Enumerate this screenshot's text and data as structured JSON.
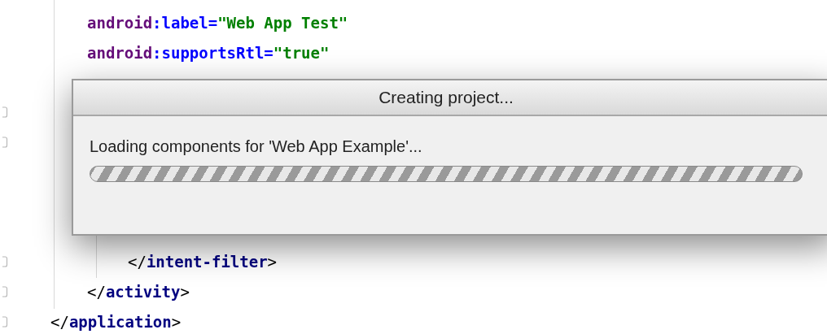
{
  "editor": {
    "lines": [
      {
        "tokens": [
          {
            "kind": "namespace",
            "text": "android"
          },
          {
            "kind": "attribute",
            "text": ":label="
          },
          {
            "kind": "value",
            "text": "\"Web App Test\""
          }
        ]
      },
      {
        "tokens": [
          {
            "kind": "namespace",
            "text": "android"
          },
          {
            "kind": "attribute",
            "text": ":supportsRtl="
          },
          {
            "kind": "value",
            "text": "\"true\""
          }
        ]
      },
      {
        "tokens": [
          {
            "kind": "punct",
            "text": "</"
          },
          {
            "kind": "tag",
            "text": "intent-filter"
          },
          {
            "kind": "punct",
            "text": ">"
          }
        ]
      },
      {
        "tokens": [
          {
            "kind": "punct",
            "text": "</"
          },
          {
            "kind": "tag",
            "text": "activity"
          },
          {
            "kind": "punct",
            "text": ">"
          }
        ]
      },
      {
        "tokens": [
          {
            "kind": "punct",
            "text": "</"
          },
          {
            "kind": "tag",
            "text": "application"
          },
          {
            "kind": "punct",
            "text": ">"
          }
        ]
      }
    ]
  },
  "dialog": {
    "title": "Creating project...",
    "message": "Loading components for 'Web App Example'...",
    "progress": {
      "indeterminate": true
    }
  }
}
